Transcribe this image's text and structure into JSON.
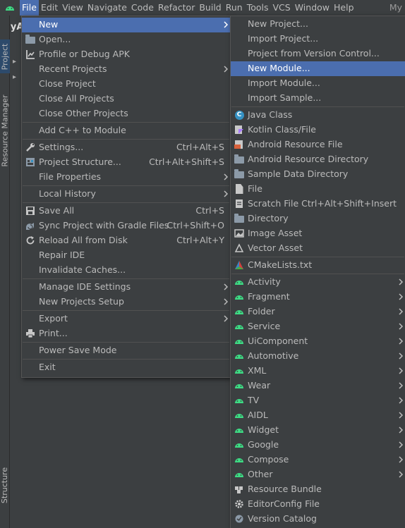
{
  "menubar": {
    "items": [
      "File",
      "Edit",
      "View",
      "Navigate",
      "Code",
      "Refactor",
      "Build",
      "Run",
      "Tools",
      "VCS",
      "Window",
      "Help"
    ],
    "right_text": "My"
  },
  "background": {
    "project_title": "MyA",
    "tab_project": "Project",
    "tab_resource_manager": "Resource Manager",
    "tab_structure": "Structure"
  },
  "file_menu": {
    "items": [
      {
        "label": "New",
        "icon": "",
        "shortcut": "",
        "submenu": true,
        "highlighted": true
      },
      {
        "label": "Open...",
        "icon": "folder-icon",
        "shortcut": "",
        "submenu": false
      },
      {
        "label": "Profile or Debug APK",
        "icon": "profile-icon",
        "shortcut": "",
        "submenu": false
      },
      {
        "label": "Recent Projects",
        "icon": "",
        "shortcut": "",
        "submenu": true
      },
      {
        "label": "Close Project",
        "icon": "",
        "shortcut": "",
        "submenu": false
      },
      {
        "label": "Close All Projects",
        "icon": "",
        "shortcut": "",
        "submenu": false
      },
      {
        "label": "Close Other Projects",
        "icon": "",
        "shortcut": "",
        "submenu": false
      },
      {
        "separator": true
      },
      {
        "label": "Add C++ to Module",
        "icon": "",
        "shortcut": "",
        "submenu": false
      },
      {
        "separator": true
      },
      {
        "label": "Settings...",
        "icon": "wrench-icon",
        "shortcut": "Ctrl+Alt+S",
        "submenu": false
      },
      {
        "label": "Project Structure...",
        "icon": "project-structure-icon",
        "shortcut": "Ctrl+Alt+Shift+S",
        "submenu": false
      },
      {
        "label": "File Properties",
        "icon": "",
        "shortcut": "",
        "submenu": true
      },
      {
        "separator": true
      },
      {
        "label": "Local History",
        "icon": "",
        "shortcut": "",
        "submenu": true
      },
      {
        "separator": true
      },
      {
        "label": "Save All",
        "icon": "save-icon",
        "shortcut": "Ctrl+S",
        "submenu": false
      },
      {
        "label": "Sync Project with Gradle Files",
        "icon": "gradle-sync-icon",
        "shortcut": "Ctrl+Shift+O",
        "submenu": false
      },
      {
        "label": "Reload All from Disk",
        "icon": "reload-icon",
        "shortcut": "Ctrl+Alt+Y",
        "submenu": false
      },
      {
        "label": "Repair IDE",
        "icon": "",
        "shortcut": "",
        "submenu": false
      },
      {
        "label": "Invalidate Caches...",
        "icon": "",
        "shortcut": "",
        "submenu": false
      },
      {
        "separator": true
      },
      {
        "label": "Manage IDE Settings",
        "icon": "",
        "shortcut": "",
        "submenu": true
      },
      {
        "label": "New Projects Setup",
        "icon": "",
        "shortcut": "",
        "submenu": true
      },
      {
        "separator": true
      },
      {
        "label": "Export",
        "icon": "",
        "shortcut": "",
        "submenu": true
      },
      {
        "label": "Print...",
        "icon": "print-icon",
        "shortcut": "",
        "submenu": false
      },
      {
        "separator": true
      },
      {
        "label": "Power Save Mode",
        "icon": "",
        "shortcut": "",
        "submenu": false
      },
      {
        "separator": true
      },
      {
        "label": "Exit",
        "icon": "",
        "shortcut": "",
        "submenu": false
      }
    ]
  },
  "new_menu": {
    "items": [
      {
        "label": "New Project...",
        "icon": "",
        "shortcut": "",
        "submenu": false
      },
      {
        "label": "Import Project...",
        "icon": "",
        "shortcut": "",
        "submenu": false
      },
      {
        "label": "Project from Version Control...",
        "icon": "",
        "shortcut": "",
        "submenu": false
      },
      {
        "label": "New Module...",
        "icon": "",
        "shortcut": "",
        "submenu": false,
        "highlighted": true
      },
      {
        "label": "Import Module...",
        "icon": "",
        "shortcut": "",
        "submenu": false
      },
      {
        "label": "Import Sample...",
        "icon": "",
        "shortcut": "",
        "submenu": false
      },
      {
        "separator": true
      },
      {
        "label": "Java Class",
        "icon": "java-class-icon",
        "shortcut": "",
        "submenu": false
      },
      {
        "label": "Kotlin Class/File",
        "icon": "kotlin-icon",
        "shortcut": "",
        "submenu": false
      },
      {
        "label": "Android Resource File",
        "icon": "android-resource-file-icon",
        "shortcut": "",
        "submenu": false
      },
      {
        "label": "Android Resource Directory",
        "icon": "folder-icon",
        "shortcut": "",
        "submenu": false
      },
      {
        "label": "Sample Data Directory",
        "icon": "folder-icon",
        "shortcut": "",
        "submenu": false
      },
      {
        "label": "File",
        "icon": "file-icon",
        "shortcut": "",
        "submenu": false
      },
      {
        "label": "Scratch File",
        "icon": "scratch-file-icon",
        "shortcut": "Ctrl+Alt+Shift+Insert",
        "submenu": false
      },
      {
        "label": "Directory",
        "icon": "folder-icon",
        "shortcut": "",
        "submenu": false
      },
      {
        "label": "Image Asset",
        "icon": "image-asset-icon",
        "shortcut": "",
        "submenu": false
      },
      {
        "label": "Vector Asset",
        "icon": "vector-asset-icon",
        "shortcut": "",
        "submenu": false
      },
      {
        "separator": true
      },
      {
        "label": "CMakeLists.txt",
        "icon": "cmake-icon",
        "shortcut": "",
        "submenu": false
      },
      {
        "separator": true
      },
      {
        "label": "Activity",
        "icon": "android-icon",
        "shortcut": "",
        "submenu": true
      },
      {
        "label": "Fragment",
        "icon": "android-icon",
        "shortcut": "",
        "submenu": true
      },
      {
        "label": "Folder",
        "icon": "android-icon",
        "shortcut": "",
        "submenu": true
      },
      {
        "label": "Service",
        "icon": "android-icon",
        "shortcut": "",
        "submenu": true
      },
      {
        "label": "UiComponent",
        "icon": "android-icon",
        "shortcut": "",
        "submenu": true
      },
      {
        "label": "Automotive",
        "icon": "android-icon",
        "shortcut": "",
        "submenu": true
      },
      {
        "label": "XML",
        "icon": "android-icon",
        "shortcut": "",
        "submenu": true
      },
      {
        "label": "Wear",
        "icon": "android-icon",
        "shortcut": "",
        "submenu": true
      },
      {
        "label": "TV",
        "icon": "android-icon",
        "shortcut": "",
        "submenu": true
      },
      {
        "label": "AIDL",
        "icon": "android-icon",
        "shortcut": "",
        "submenu": true
      },
      {
        "label": "Widget",
        "icon": "android-icon",
        "shortcut": "",
        "submenu": true
      },
      {
        "label": "Google",
        "icon": "android-icon",
        "shortcut": "",
        "submenu": true
      },
      {
        "label": "Compose",
        "icon": "android-icon",
        "shortcut": "",
        "submenu": true
      },
      {
        "label": "Other",
        "icon": "android-icon",
        "shortcut": "",
        "submenu": true
      },
      {
        "label": "Resource Bundle",
        "icon": "resource-bundle-icon",
        "shortcut": "",
        "submenu": false
      },
      {
        "label": "EditorConfig File",
        "icon": "gear-icon",
        "shortcut": "",
        "submenu": false
      },
      {
        "label": "Version Catalog",
        "icon": "version-catalog-icon",
        "shortcut": "",
        "submenu": false
      }
    ]
  },
  "colors": {
    "background": "#3c3f41",
    "highlight": "#4b6eaf",
    "text": "#bbbbbb",
    "android_green": "#3ddc84"
  }
}
